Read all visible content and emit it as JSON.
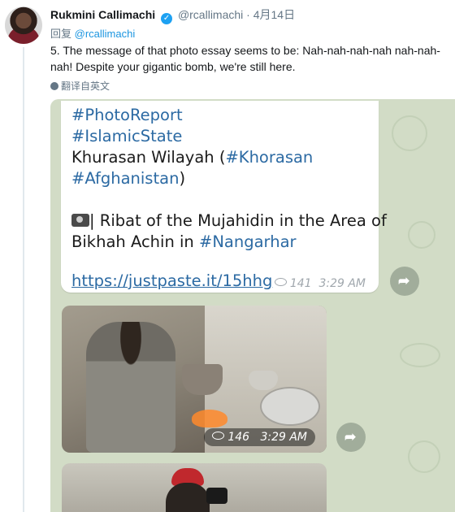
{
  "tweet": {
    "name": "Rukmini Callimachi",
    "verified_glyph": "✓",
    "handle": "@rcallimachi",
    "separator": "·",
    "date": "4月14日",
    "reply_prefix": "回复",
    "reply_mention": "@rcallimachi",
    "text": "5. The message of that photo essay seems to be: Nah-nah-nah-nah nah-nah-nah! Despite your gigantic bomb, we're still here.",
    "translate_label": "翻译自英文",
    "translate_icon": "globe-icon"
  },
  "telegram": {
    "line1": "#PhotoReport",
    "line2": "#IslamicState",
    "line3_text": "Khurasan Wilayah (",
    "line3_tag": "#Khorasan",
    "line4_tag": "#Afghanistan",
    "line4_text": ")",
    "line5": "| Ribat of the Mujahidin in the Area of",
    "line6_text": "Bikhah Achin in ",
    "line6_tag": "#Nangarhar",
    "link": "https://justpaste.it/15hhg",
    "views": "141",
    "time": "3:29 AM",
    "photo_views": "146",
    "photo_time": "3:29 AM",
    "forward_glyph": "➦"
  },
  "colors": {
    "accent": "#1da1f2",
    "hashtag": "#2c6aa3",
    "chat_bg": "#d2dcc6"
  }
}
